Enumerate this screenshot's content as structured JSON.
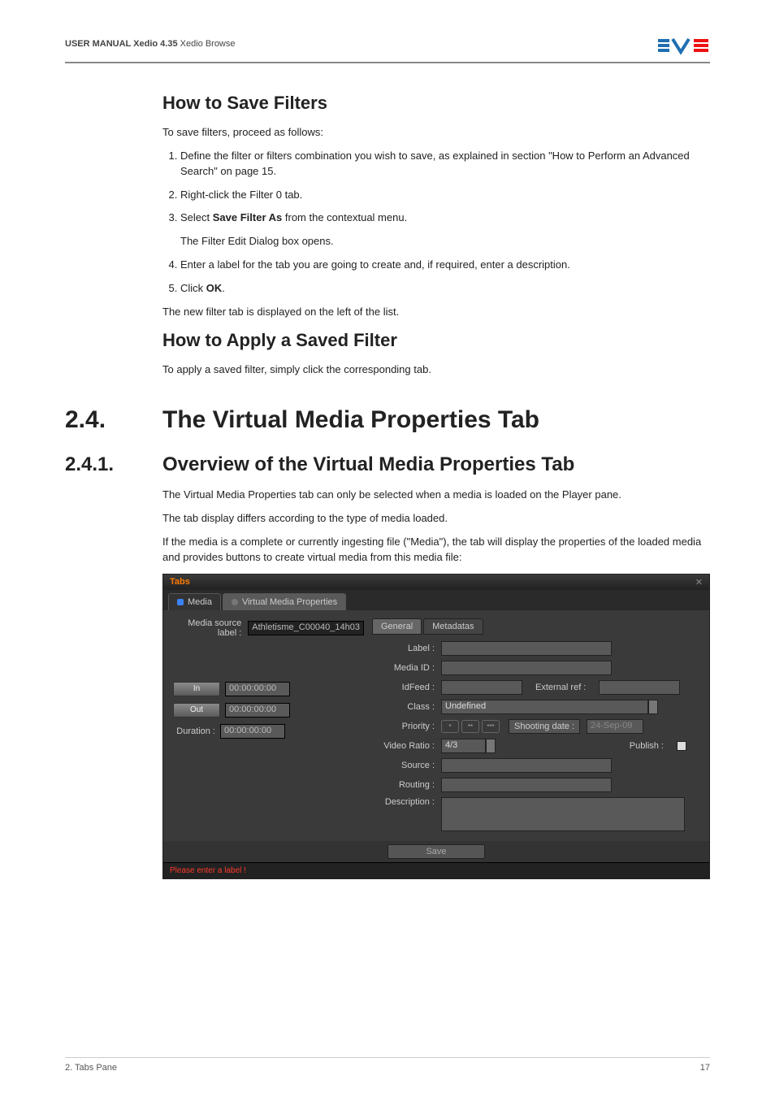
{
  "header": {
    "manual_prefix": "USER MANUAL",
    "product": "Xedio 4.35",
    "module": "Xedio Browse"
  },
  "sections": {
    "save_filters": {
      "title": "How to Save Filters",
      "intro": "To save filters, proceed as follows:",
      "steps": [
        "Define the filter or filters combination you wish to save, as explained in section \"How to Perform an Advanced Search\" on page 15.",
        "Right-click the Filter 0 tab.",
        "Select Save Filter As from the contextual menu.",
        "Enter a label for the tab you are going to create and, if required, enter a description.",
        "Click OK."
      ],
      "step3_sub": "The Filter Edit Dialog box opens.",
      "after": "The new filter tab is displayed on the left of the list."
    },
    "apply_filter": {
      "title": "How to Apply a Saved Filter",
      "body": "To apply a saved filter, simply click the corresponding tab."
    },
    "vmp": {
      "num": "2.4.",
      "title": "The Virtual Media Properties Tab"
    },
    "vmp_overview": {
      "num": "2.4.1.",
      "title": "Overview of the Virtual Media Properties Tab",
      "p1": "The Virtual Media Properties tab can only be selected when a media is loaded on the Player pane.",
      "p2": "The tab display differs according to the type of media loaded.",
      "p3": "If the media is a complete or currently ingesting file (\"Media\"), the tab will display the properties of the loaded media and provides buttons to create virtual media from this media file:"
    }
  },
  "screenshot": {
    "window_title": "Tabs",
    "tabs": {
      "media": "Media",
      "vmp": "Virtual Media Properties"
    },
    "left": {
      "media_source_label_lbl": "Media source label :",
      "media_source_label_val": "Athletisme_C00040_14h03",
      "in_btn": "In",
      "in_val": "00:00:00:00",
      "out_btn": "Out",
      "out_val": "00:00:00:00",
      "dur_lbl": "Duration :",
      "dur_val": "00:00:00:00"
    },
    "right": {
      "inner_tabs": {
        "general": "General",
        "metadatas": "Metadatas"
      },
      "labels": {
        "label": "Label :",
        "media_id": "Media ID :",
        "idfeed": "IdFeed :",
        "external_ref": "External ref :",
        "class": "Class :",
        "class_val": "Undefined",
        "priority": "Priority :",
        "priority_opts": [
          "*",
          "**",
          "***"
        ],
        "shooting_date": "Shooting date :",
        "shooting_date_val": "24-Sep-09",
        "video_ratio": "Video Ratio :",
        "video_ratio_val": "4/3",
        "publish": "Publish :",
        "source": "Source :",
        "routing": "Routing :",
        "description": "Description :"
      }
    },
    "save_btn": "Save",
    "error": "Please enter a label !"
  },
  "footer": {
    "left": "2. Tabs Pane",
    "right": "17"
  }
}
